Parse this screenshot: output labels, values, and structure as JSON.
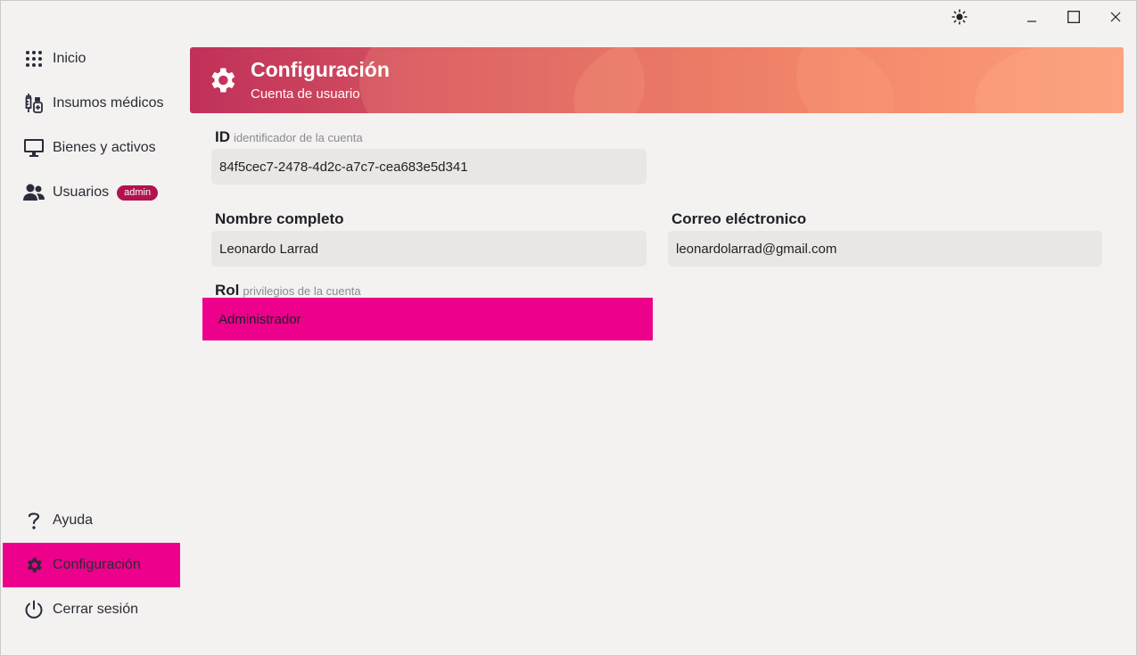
{
  "sidebar": {
    "items": [
      {
        "label": "Inicio",
        "icon": "grid-dots-icon"
      },
      {
        "label": "Insumos médicos",
        "icon": "medical-supplies-icon"
      },
      {
        "label": "Bienes y activos",
        "icon": "monitor-icon"
      },
      {
        "label": "Usuarios",
        "icon": "users-icon",
        "badge": "admin"
      }
    ],
    "bottom_items": [
      {
        "label": "Ayuda",
        "icon": "question-icon"
      },
      {
        "label": "Configuración",
        "icon": "gear-icon",
        "active": true
      },
      {
        "label": "Cerrar sesión",
        "icon": "power-icon"
      }
    ]
  },
  "banner": {
    "title": "Configuración",
    "subtitle": "Cuenta de usuario"
  },
  "form": {
    "id": {
      "label": "ID",
      "hint": "identificador de la cuenta",
      "value": "84f5cec7-2478-4d2c-a7c7-cea683e5d341"
    },
    "name": {
      "label": "Nombre completo",
      "value": "Leonardo Larrad"
    },
    "email": {
      "label": "Correo eléctronico",
      "value": "leonardolarrad@gmail.com"
    },
    "role": {
      "label": "Rol",
      "hint": "privilegios de la cuenta",
      "value": "Administrador"
    }
  },
  "colors": {
    "accent": "#ec008c",
    "badge": "#b0134f",
    "input_bg": "#e9e7e4",
    "background": "#f3f2f1"
  }
}
